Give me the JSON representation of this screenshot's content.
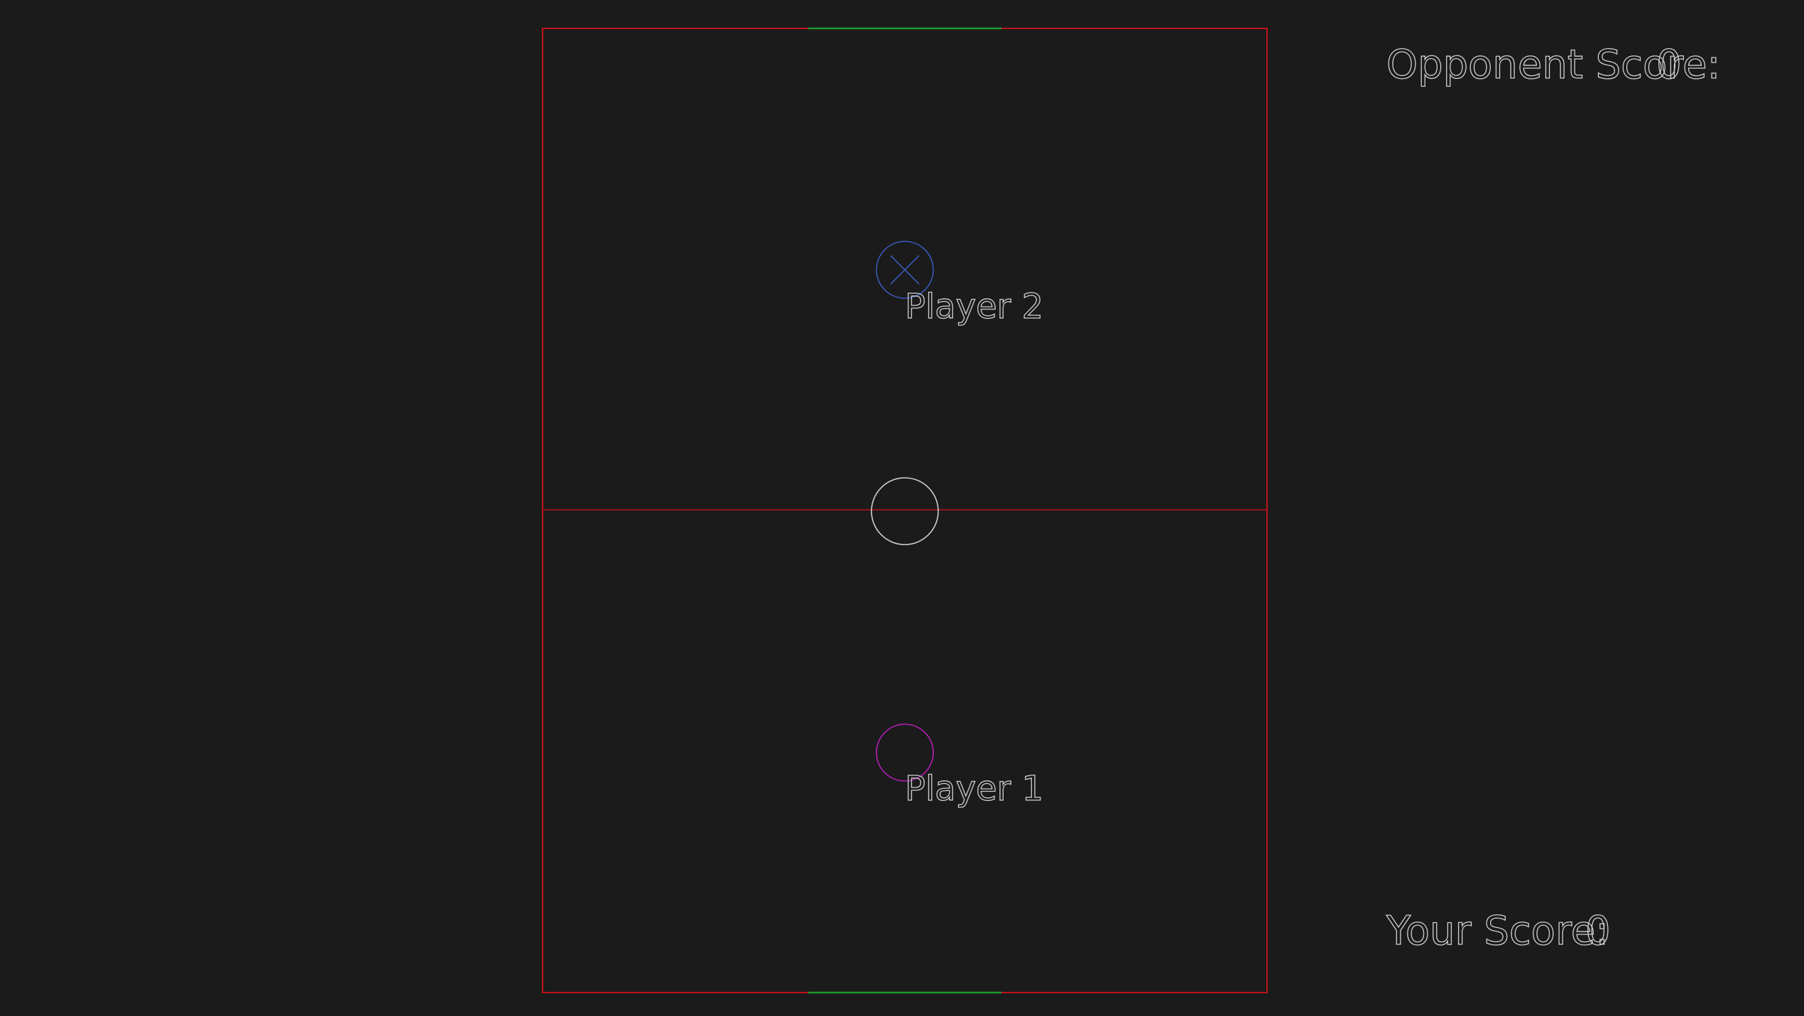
{
  "hud": {
    "opponent_score_label": "Opponent Score:",
    "opponent_score_value": "0",
    "your_score_label": "Your Score:",
    "your_score_value": "0"
  },
  "players": {
    "player2_label": "Player 2",
    "player1_label": "Player 1"
  },
  "colors": {
    "background": "#1b1b1b",
    "boundary": "#c0121a",
    "goal": "#1c9a2c",
    "puck": "#cfcfcf",
    "player2": "#3a58b8",
    "player1": "#b21fb4",
    "text": "#cfcfcf"
  }
}
